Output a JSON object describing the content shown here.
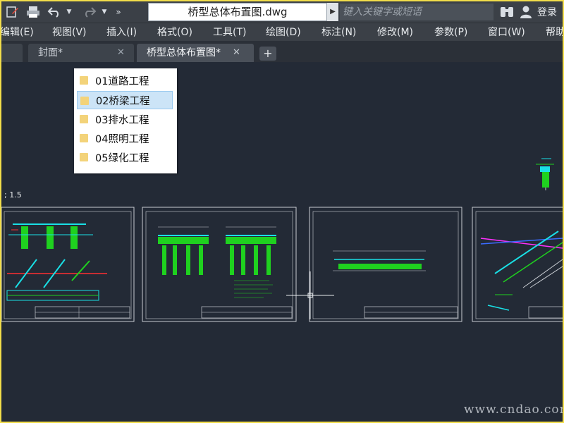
{
  "titlebar": {
    "document_title": "桥型总体布置图.dwg",
    "search_placeholder": "键入关键字或短语",
    "login_label": "登录",
    "quick_access_icons": [
      "edit-icon",
      "print-icon",
      "undo-icon",
      "redo-icon",
      "more-icon"
    ]
  },
  "menu": {
    "items": [
      "编辑(E)",
      "视图(V)",
      "插入(I)",
      "格式(O)",
      "工具(T)",
      "绘图(D)",
      "标注(N)",
      "修改(M)",
      "参数(P)",
      "窗口(W)",
      "帮助"
    ]
  },
  "tabs": [
    {
      "label": "封面*",
      "active": false
    },
    {
      "label": "桥型总体布置图*",
      "active": true
    }
  ],
  "folder_dropdown": {
    "items": [
      {
        "label": "01道路工程",
        "selected": false
      },
      {
        "label": "02桥梁工程",
        "selected": true
      },
      {
        "label": "03排水工程",
        "selected": false
      },
      {
        "label": "04照明工程",
        "selected": false
      },
      {
        "label": "05绿化工程",
        "selected": false
      }
    ]
  },
  "canvas": {
    "scale_text": "; 1.5",
    "watermark": "www.cndao.com",
    "colors": {
      "background": "#232a36",
      "frame": "#c8ccd2",
      "cyan": "#19e0e6",
      "green": "#1fd11f",
      "red": "#ff3030",
      "magenta": "#ff30ff",
      "blue": "#3a6bff"
    }
  }
}
